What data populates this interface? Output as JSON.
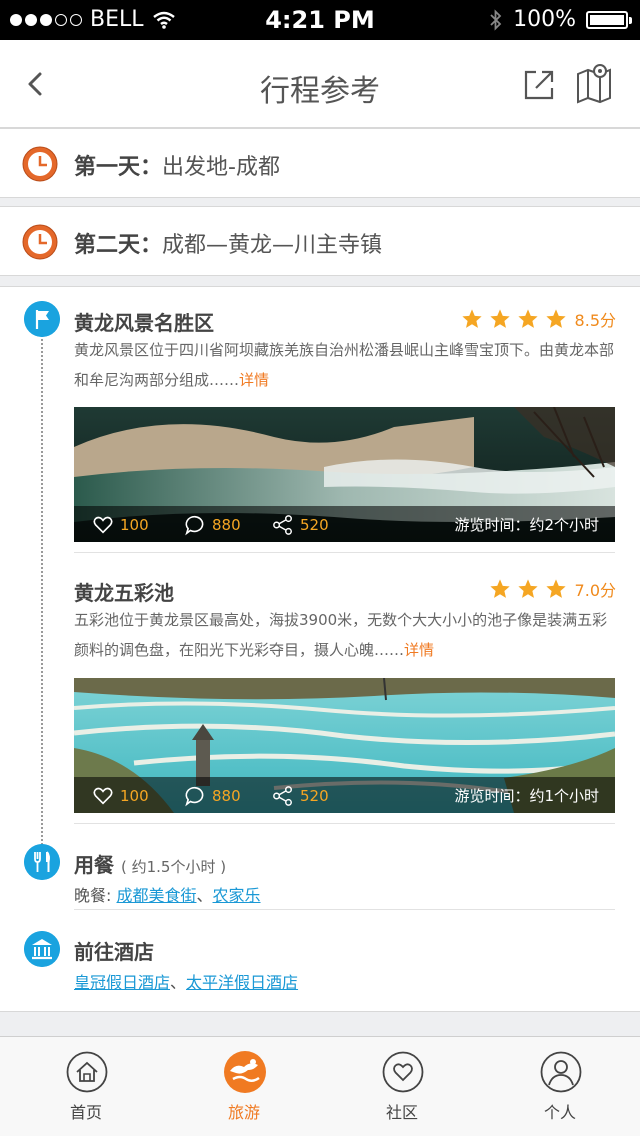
{
  "status_bar": {
    "carrier": "BELL",
    "time": "4:21 PM",
    "battery": "100%"
  },
  "nav": {
    "title": "行程参考",
    "back_icon": "chevron-left-icon",
    "share_icon": "share-icon",
    "map_icon": "map-pin-icon"
  },
  "days": [
    {
      "label": "第一天",
      "route": "出发地-成都"
    },
    {
      "label": "第二天",
      "route": "成都—黄龙—川主寺镇"
    }
  ],
  "pois": [
    {
      "title": "黄龙风景名胜区",
      "stars": 4,
      "score": "8.5分",
      "desc": "黄龙风景区位于四川省阿坝藏族羌族自治州松潘县岷山主峰雪宝顶下。由黄龙本部和牟尼沟两部分组成……",
      "more": "详情",
      "likes": "100",
      "comments": "880",
      "shares": "520",
      "visit": "游览时间：约2个小时"
    },
    {
      "title": "黄龙五彩池",
      "stars": 3,
      "score": "7.0分",
      "desc": "五彩池位于黄龙景区最高处，海拔3900米，无数个大大小小的池子像是装满五彩颜料的调色盘，在阳光下光彩夺目，摄人心魄……",
      "more": "详情",
      "likes": "100",
      "comments": "880",
      "shares": "520",
      "visit": "游览时间：约1个小时"
    }
  ],
  "meal": {
    "title": "用餐",
    "duration": "( 约1.5个小时 )",
    "prefix": "晚餐: ",
    "links": [
      "成都美食街",
      "农家乐"
    ],
    "sep": "、"
  },
  "hotel": {
    "title": "前往酒店",
    "links": [
      "皇冠假日酒店",
      "太平洋假日酒店"
    ],
    "sep": "、"
  },
  "tabs": [
    {
      "label": "首页",
      "icon": "home-icon"
    },
    {
      "label": "旅游",
      "icon": "travel-icon",
      "active": true
    },
    {
      "label": "社区",
      "icon": "heart-icon"
    },
    {
      "label": "个人",
      "icon": "user-icon"
    }
  ],
  "colors": {
    "accent": "#f07a22",
    "timeline_blue": "#1aa3df",
    "link_blue": "#1a98d5",
    "star": "#f5a623"
  }
}
